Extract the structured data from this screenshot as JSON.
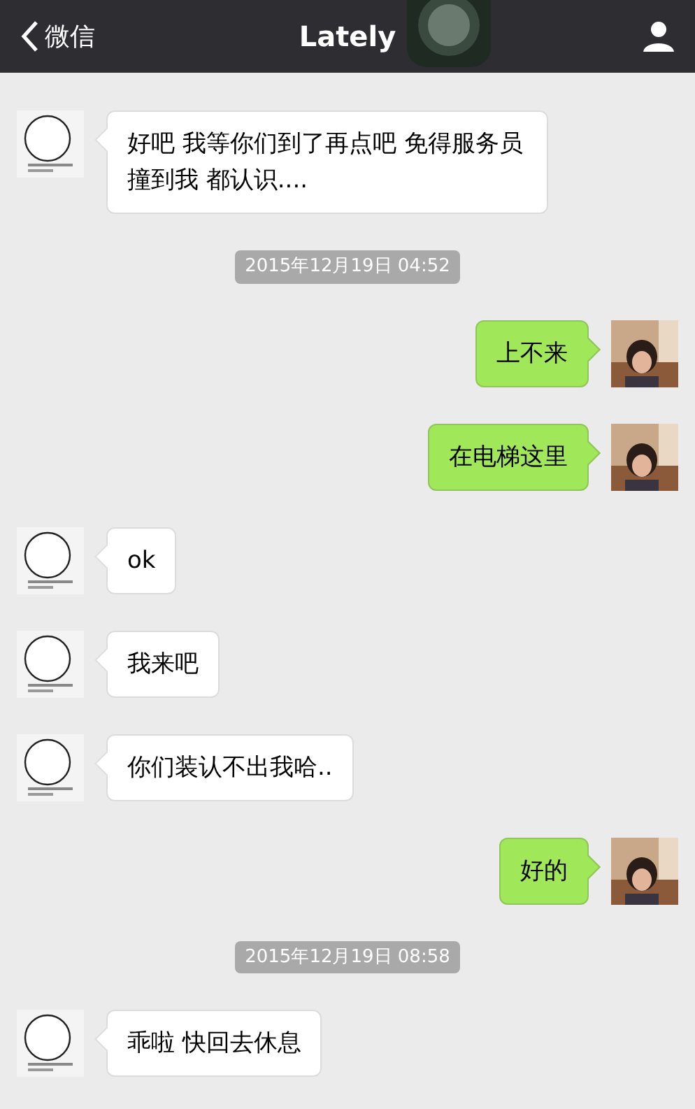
{
  "nav_bar": {
    "back_label": "微信",
    "title": "Lately"
  },
  "messages": [
    {
      "kind": "incoming",
      "text": "好吧 我等你们到了再点吧 免得服务员撞到我 都认识...."
    },
    {
      "kind": "time",
      "text": "2015年12月19日 04:52"
    },
    {
      "kind": "outgoing",
      "text": "上不来"
    },
    {
      "kind": "outgoing",
      "text": "在电梯这里"
    },
    {
      "kind": "incoming",
      "text": "ok"
    },
    {
      "kind": "incoming",
      "text": "我来吧"
    },
    {
      "kind": "incoming",
      "text": "你们装认不出我哈.."
    },
    {
      "kind": "outgoing",
      "text": "好的"
    },
    {
      "kind": "time",
      "text": "2015年12月19日 08:58"
    },
    {
      "kind": "incoming",
      "text": "乖啦 快回去休息"
    }
  ]
}
